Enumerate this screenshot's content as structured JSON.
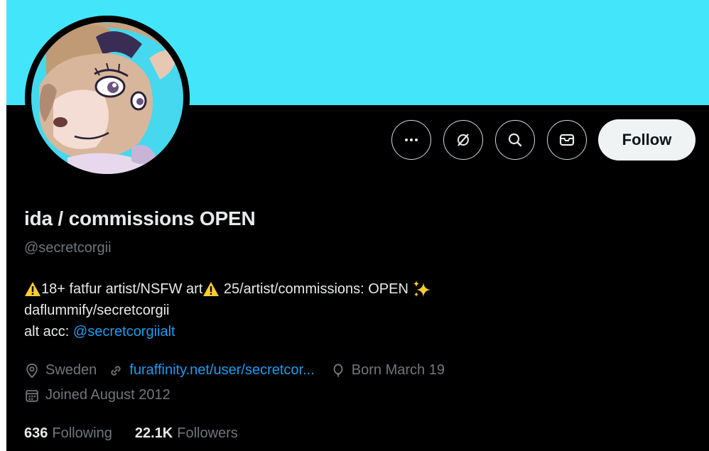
{
  "theme": {
    "banner_color": "#43e5fb",
    "link_color": "#1d9bf0",
    "muted_color": "#71767b"
  },
  "actions": {
    "more_icon": "more-icon",
    "grok_icon": "grok-icon",
    "search_icon": "search-icon",
    "message_icon": "mail-icon",
    "follow_label": "Follow"
  },
  "profile": {
    "display_name": "ida / commissions OPEN",
    "handle": "@secretcorgii",
    "bio": {
      "line1_a": "18+ fatfur artist/NSFW art",
      "line1_b": " 25/artist/commissions: OPEN ",
      "line2": "daflummify/secretcorgii",
      "line3_prefix": "alt acc: ",
      "line3_link": "@secretcorgiialt"
    },
    "location": "Sweden",
    "website": "furaffinity.net/user/secretcor...",
    "birthday": "Born March 19",
    "joined": "Joined August 2012",
    "following_count": "636",
    "following_label": "Following",
    "followers_count": "22.1K",
    "followers_label": "Followers"
  }
}
